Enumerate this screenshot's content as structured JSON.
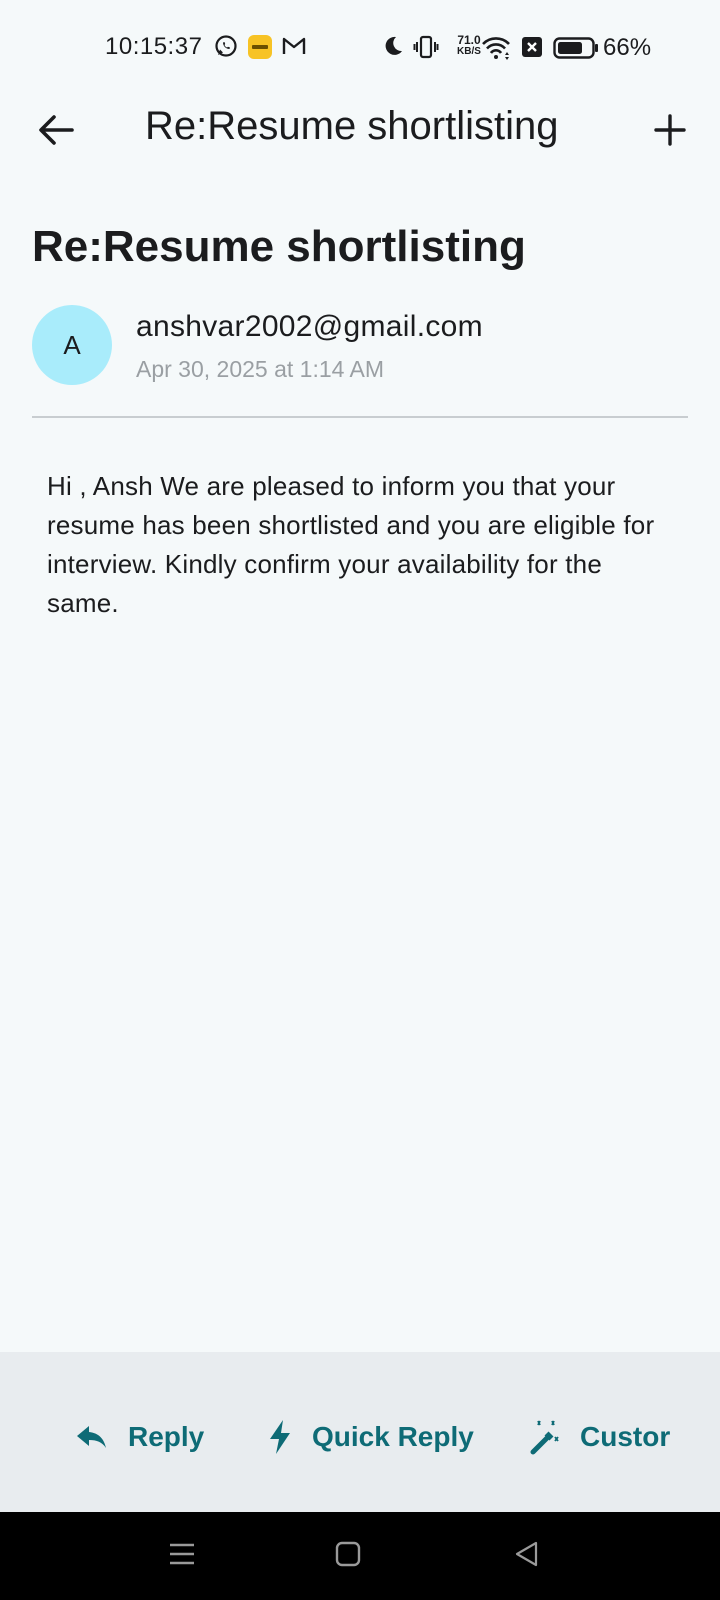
{
  "status_bar": {
    "time": "10:15:37",
    "net_speed_value": "71.0",
    "net_speed_unit": "KB/S",
    "battery": "66%",
    "icons": [
      "whatsapp-icon",
      "app-icon",
      "gmail-icon",
      "moon-icon",
      "vibrate-icon",
      "wifi-icon",
      "close-box-icon",
      "battery-icon"
    ]
  },
  "app_bar": {
    "title": "Re:Resume shortlisting",
    "back_icon": "arrow-back-icon",
    "add_icon": "plus-icon"
  },
  "mail": {
    "subject": "Re:Resume shortlisting",
    "avatar_letter": "A",
    "sender": "anshvar2002@gmail.com",
    "date": "Apr 30, 2025 at 1:14 AM",
    "body": "Hi , Ansh We are pleased to inform you that your resume has been shortlisted and you are eligible for interview. Kindly confirm your availability for the same."
  },
  "actions": {
    "reply": "Reply",
    "quick_reply": "Quick Reply",
    "custom": "Custor"
  },
  "colors": {
    "background": "#f5f9fa",
    "avatar": "#a9ecfb",
    "accent": "#0e6b76",
    "action_bar": "#e8ecef"
  }
}
